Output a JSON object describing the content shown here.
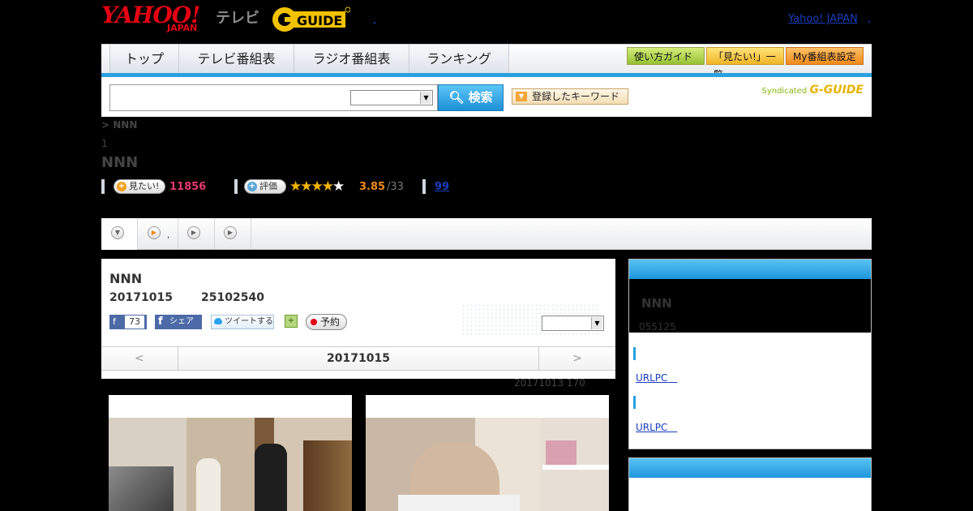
{
  "header": {
    "logo_yahoo": "YAHOO!",
    "logo_japan": "JAPAN",
    "logo_tv": "テレビ",
    "logo_gguide": "G-GUIDE",
    "yahoo_link": "Yahoo! JAPAN",
    "yahoo_link_suffix": ","
  },
  "nav": {
    "tabs": [
      {
        "label": "トップ"
      },
      {
        "label": "テレビ番組表"
      },
      {
        "label": "ラジオ番組表"
      },
      {
        "label": "ランキング"
      }
    ],
    "right_buttons": [
      {
        "label": "使い方ガイド"
      },
      {
        "label": "「見たい!」一覧"
      },
      {
        "label": "My番組表設定"
      }
    ],
    "accent_color": "#2aa0e0"
  },
  "search": {
    "input_value": "",
    "select_value": "",
    "button_label": "検索",
    "keyword_button": "登録したキーワード",
    "syndicated_label": "Syndicated",
    "syndicated_brand": "G-GUIDE"
  },
  "program": {
    "breadcrumb": "> NNN",
    "index": "1",
    "title": "NNN",
    "want_label": "見たい!",
    "want_count": "11856",
    "rate_label": "評価",
    "stars_filled": "★★★★",
    "stars_empty": "★",
    "rating_value": 3.85,
    "rating_total": "/33",
    "review_link": "99"
  },
  "strip": {
    "tab2_suffix": ","
  },
  "main": {
    "title": "NNN",
    "date": "20171015",
    "code": "25102540",
    "fb_like_count": "73",
    "fb_share_label": "シェア",
    "tweet_label": "ツイートする",
    "reserve_label": "予約",
    "select_value": "",
    "date_prev": "<",
    "date_current": "20171015",
    "date_next": ">",
    "meta_line": "20171013  170"
  },
  "sidebar": {
    "title": "NNN",
    "sub": "055125",
    "link1": "URLPC　",
    "link2": "URLPC　"
  }
}
